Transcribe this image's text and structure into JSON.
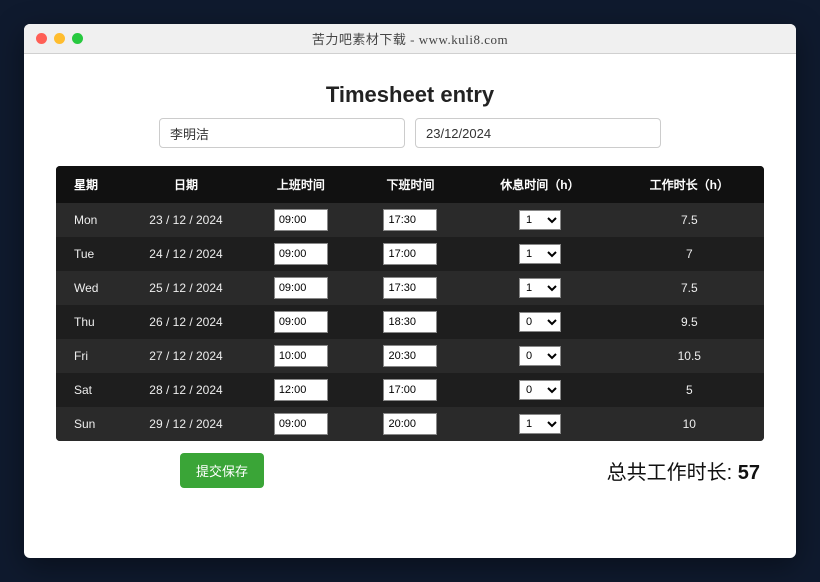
{
  "window": {
    "title": "苦力吧素材下载 - www.kuli8.com"
  },
  "page": {
    "title": "Timesheet entry"
  },
  "form": {
    "name_value": "李明洁",
    "date_value": "23/12/2024"
  },
  "table": {
    "headers": {
      "day": "星期",
      "date": "日期",
      "start": "上班时间",
      "end": "下班时间",
      "break": "休息时间（h）",
      "worked": "工作时长（h）"
    },
    "rows": [
      {
        "day": "Mon",
        "date": "23 / 12 / 2024",
        "start": "09:00",
        "end": "17:30",
        "break": "1",
        "worked": "7.5"
      },
      {
        "day": "Tue",
        "date": "24 / 12 / 2024",
        "start": "09:00",
        "end": "17:00",
        "break": "1",
        "worked": "7"
      },
      {
        "day": "Wed",
        "date": "25 / 12 / 2024",
        "start": "09:00",
        "end": "17:30",
        "break": "1",
        "worked": "7.5"
      },
      {
        "day": "Thu",
        "date": "26 / 12 / 2024",
        "start": "09:00",
        "end": "18:30",
        "break": "0",
        "worked": "9.5"
      },
      {
        "day": "Fri",
        "date": "27 / 12 / 2024",
        "start": "10:00",
        "end": "20:30",
        "break": "0",
        "worked": "10.5"
      },
      {
        "day": "Sat",
        "date": "28 / 12 / 2024",
        "start": "12:00",
        "end": "17:00",
        "break": "0",
        "worked": "5"
      },
      {
        "day": "Sun",
        "date": "29 / 12 / 2024",
        "start": "09:00",
        "end": "20:00",
        "break": "1",
        "worked": "10"
      }
    ]
  },
  "footer": {
    "submit_label": "提交保存",
    "total_label": "总共工作时长: ",
    "total_value": "57"
  }
}
